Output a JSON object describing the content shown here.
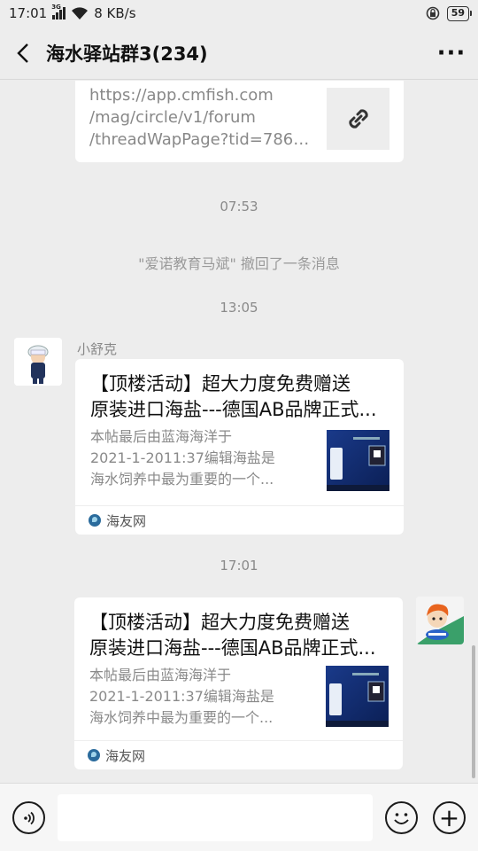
{
  "status_bar": {
    "time": "17:01",
    "network_tag": "3G",
    "speed": "8 KB/s",
    "battery": "59",
    "icons": [
      "signal-icon",
      "wifi-icon",
      "alarm-icon",
      "battery-icon"
    ]
  },
  "header": {
    "title": "海水驿站群3(234)",
    "back_icon": "chevron-left-icon",
    "more_icon": "more-dots-icon",
    "more_label": "···"
  },
  "messages": {
    "link_card": {
      "url_lines": [
        "https://app.cmfish.com",
        "/mag/circle/v1/forum",
        "/threadWapPage?tid=78601..."
      ],
      "thumb_icon": "link-icon"
    },
    "time_1": "07:53",
    "recall_notice": "\"爱诺教育马斌\" 撤回了一条消息",
    "time_2": "13:05",
    "received": {
      "sender": "小舒克",
      "title_lines": [
        "【顶楼活动】超大力度免费赠送",
        "原装进口海盐---德国AB品牌正式..."
      ],
      "desc_lines": [
        "本帖最后由蓝海海洋于",
        "2021-1-2011:37编辑海盐是",
        "海水饲养中最为重要的一个..."
      ],
      "source": "海友网"
    },
    "time_3": "17:01",
    "sent": {
      "title_lines": [
        "【顶楼活动】超大力度免费赠送",
        "原装进口海盐---德国AB品牌正式..."
      ],
      "desc_lines": [
        "本帖最后由蓝海海洋于",
        "2021-1-2011:37编辑海盐是",
        "海水饲养中最为重要的一个..."
      ],
      "source": "海友网"
    }
  },
  "input_bar": {
    "placeholder": "",
    "icons": [
      "voice-icon",
      "emoji-icon",
      "plus-icon"
    ],
    "plus_label": "+"
  },
  "colors": {
    "background": "#ededed",
    "card": "#ffffff",
    "meta_text": "#8a8a8a"
  }
}
